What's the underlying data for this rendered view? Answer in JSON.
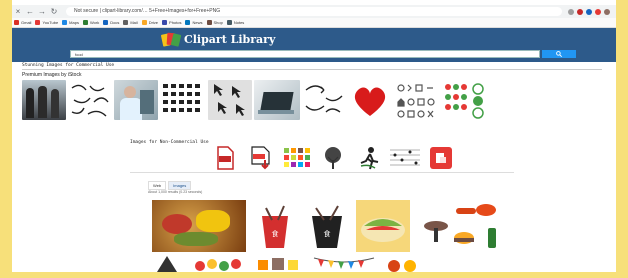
{
  "browser": {
    "url": "Not secure | clipart-library.com/… 5+Free+Images+for+Free+PNG",
    "bookmarks": [
      {
        "label": "Gmail",
        "color": "#d93025"
      },
      {
        "label": "YouTube",
        "color": "#e53935"
      },
      {
        "label": "Maps",
        "color": "#1e88e5"
      },
      {
        "label": "Work",
        "color": "#2e7d32"
      },
      {
        "label": "Docs",
        "color": "#1565c0"
      },
      {
        "label": "Mail",
        "color": "#616161"
      },
      {
        "label": "Drive",
        "color": "#f9a825"
      },
      {
        "label": "Photos",
        "color": "#3949ab"
      },
      {
        "label": "News",
        "color": "#0277bd"
      },
      {
        "label": "Shop",
        "color": "#6d4c41"
      },
      {
        "label": "Notes",
        "color": "#455a64"
      }
    ]
  },
  "site": {
    "logo_text": "Clipart Library",
    "search_value": "food",
    "colors": {
      "header": "#2d5a8a",
      "accent": "#2196f3"
    }
  },
  "sections": {
    "stock_title": "Stunning Images for Commercial Use",
    "premium_title": "Premium Images by iStock",
    "free_title": "Images for Non-Commercial Use"
  },
  "tabs": [
    {
      "label": "Web"
    },
    {
      "label": "Images",
      "active": true
    }
  ],
  "results_text": "About 1,000 results (0.23 seconds)"
}
